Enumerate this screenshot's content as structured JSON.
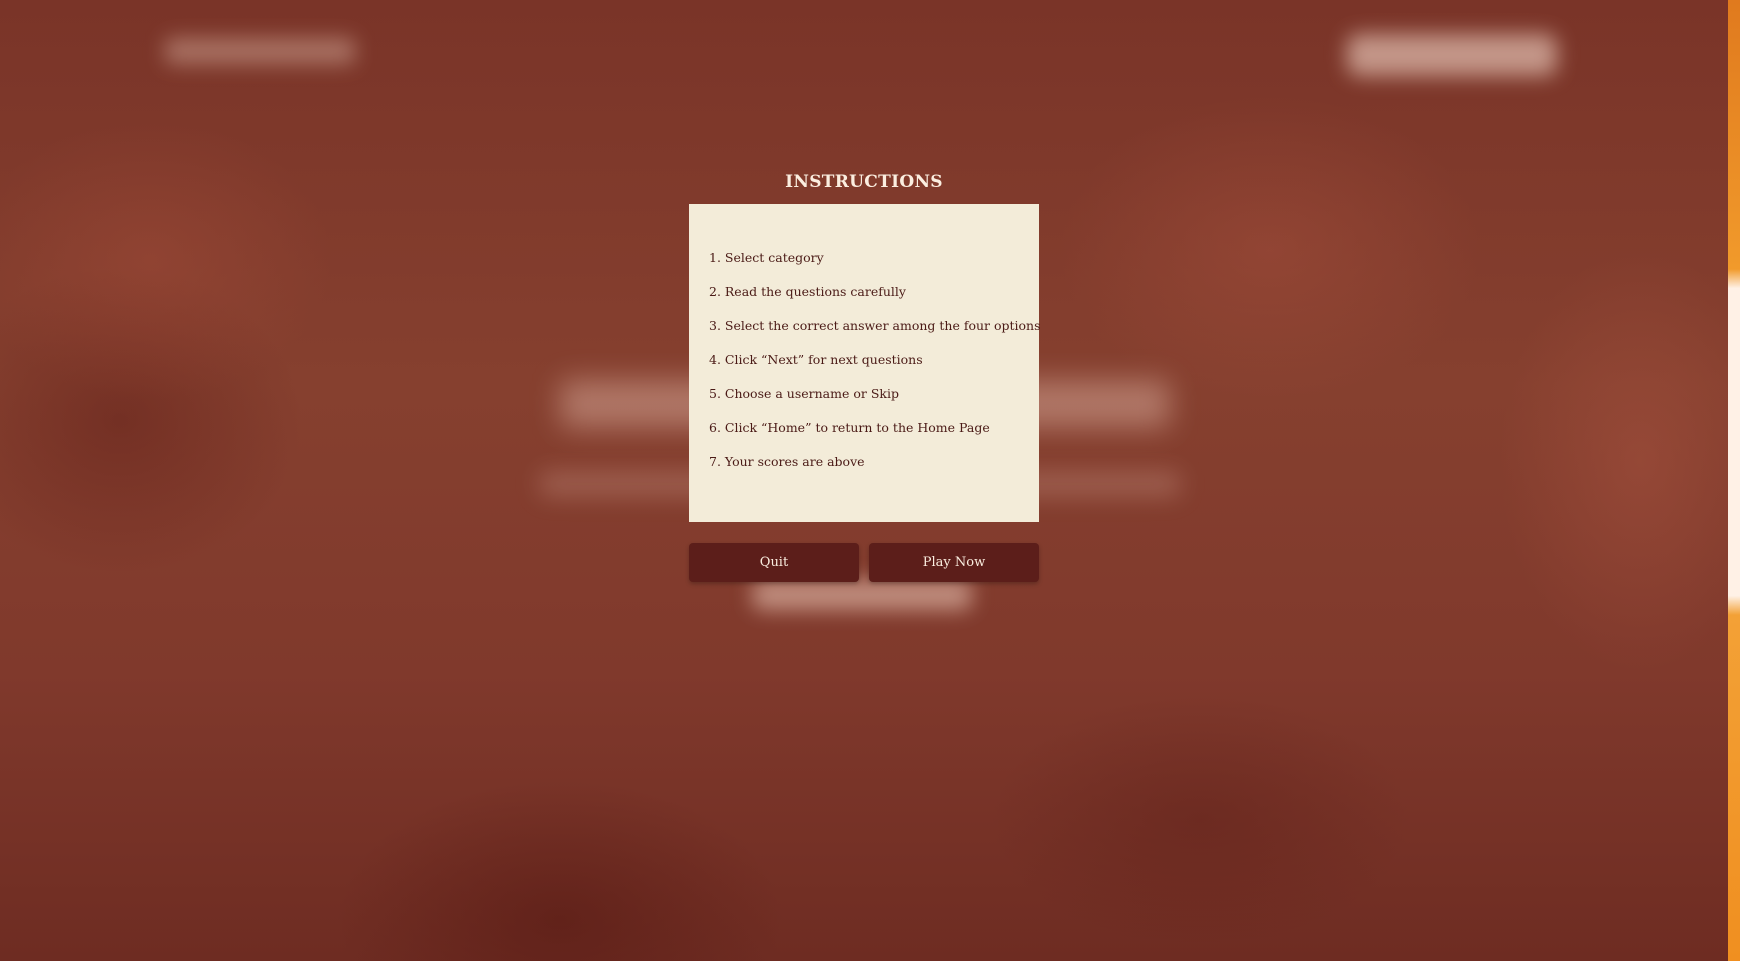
{
  "modal": {
    "title": "INSTRUCTIONS",
    "steps": [
      "1. Select category",
      "2. Read the questions carefully",
      "3. Select the correct answer among the four options",
      "4. Click “Next” for next questions",
      "5. Choose a username or Skip",
      "6. Click “Home” to return to the Home Page",
      "7. Your scores are above"
    ],
    "quit_label": "Quit",
    "play_label": "Play Now"
  },
  "colors": {
    "background": "#80382c",
    "panel": "#f3ecd9",
    "button": "#5c1e1a",
    "text_dark": "#4a1a16",
    "text_light": "#fbeee0",
    "scrollbar_accent": "#f19a2b"
  }
}
